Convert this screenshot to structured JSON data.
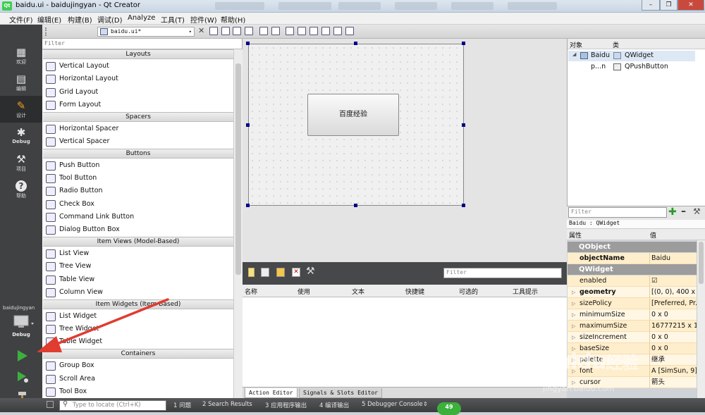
{
  "window": {
    "title": "baidu.ui - baidujingyan - Qt Creator",
    "icon_label": "Qt",
    "controls": [
      "–",
      "❐",
      "✕"
    ]
  },
  "menu": [
    "文件(F)",
    "编辑(E)",
    "构建(B)",
    "调试(D)",
    "Analyze",
    "工具(T)",
    "控件(W)",
    "帮助(H)"
  ],
  "modes": [
    {
      "label": "欢迎",
      "icon": "grid-icon"
    },
    {
      "label": "编辑",
      "icon": "document-icon"
    },
    {
      "label": "设计",
      "icon": "pencil-icon"
    },
    {
      "label": "Debug",
      "icon": "bug-icon"
    },
    {
      "label": "项目",
      "icon": "wrench-icon"
    },
    {
      "label": "帮助",
      "icon": "help-icon"
    }
  ],
  "run_target": {
    "project": "baidujingyan",
    "config": "Debug"
  },
  "editor": {
    "open_document": "baidu.ui*"
  },
  "widget_box": {
    "filter_placeholder": "Filter",
    "categories": [
      {
        "name": "Layouts",
        "items": [
          "Vertical Layout",
          "Horizontal Layout",
          "Grid Layout",
          "Form Layout"
        ]
      },
      {
        "name": "Spacers",
        "items": [
          "Horizontal Spacer",
          "Vertical Spacer"
        ]
      },
      {
        "name": "Buttons",
        "items": [
          "Push Button",
          "Tool Button",
          "Radio Button",
          "Check Box",
          "Command Link Button",
          "Dialog Button Box"
        ]
      },
      {
        "name": "Item Views (Model-Based)",
        "items": [
          "List View",
          "Tree View",
          "Table View",
          "Column View"
        ]
      },
      {
        "name": "Item Widgets (Item-Based)",
        "items": [
          "List Widget",
          "Tree Widget",
          "Table Widget"
        ]
      },
      {
        "name": "Containers",
        "items": [
          "Group Box",
          "Scroll Area",
          "Tool Box"
        ]
      }
    ]
  },
  "form": {
    "push_button_text": "百度经验"
  },
  "action_editor": {
    "filter_placeholder": "Filter",
    "columns": [
      "名称",
      "使用",
      "文本",
      "快捷键",
      "可选的",
      "工具提示"
    ],
    "tabs": [
      "Action Editor",
      "Signals & Slots Editor"
    ]
  },
  "object_inspector": {
    "columns": [
      "对象",
      "类"
    ],
    "rows": [
      {
        "object": "Baidu",
        "class": "QWidget"
      },
      {
        "object": "p...n",
        "class": "QPushButton"
      }
    ]
  },
  "property_editor": {
    "filter_placeholder": "Filter",
    "class_label": "Baidu : QWidget",
    "columns": [
      "属性",
      "值"
    ],
    "groups": [
      {
        "name": "QObject",
        "rows": [
          {
            "name": "objectName",
            "value": "Baidu",
            "bold": true
          }
        ]
      },
      {
        "name": "QWidget",
        "rows": [
          {
            "name": "enabled",
            "value": "☑"
          },
          {
            "name": "geometry",
            "value": "[(0, 0), 400 x 3...",
            "bold": true
          },
          {
            "name": "sizePolicy",
            "value": "[Preferred, Pr..."
          },
          {
            "name": "minimumSize",
            "value": "0 x 0"
          },
          {
            "name": "maximumSize",
            "value": "16777215 x 1..."
          },
          {
            "name": "sizeIncrement",
            "value": "0 x 0"
          },
          {
            "name": "baseSize",
            "value": "0 x 0"
          },
          {
            "name": "palette",
            "value": "继承"
          },
          {
            "name": "font",
            "value": "A [SimSun, 9]"
          },
          {
            "name": "cursor",
            "value": "箭头"
          }
        ]
      }
    ]
  },
  "status_bar": {
    "locator_placeholder": "Type to locate (Ctrl+K)",
    "panes": [
      "1 问题",
      "2 Search Results",
      "3 应用程序输出",
      "4 编译输出",
      "5 Debugger Console"
    ],
    "badge": "49"
  },
  "watermark": {
    "brand": "Baidu",
    "suffix": "经验",
    "url": "jingyan.baidu.com"
  },
  "colors": {
    "modebar": "#3f4143",
    "selection_handle": "#00008b",
    "arrow": "#e03c2f",
    "property_row": "#ffeecb"
  }
}
